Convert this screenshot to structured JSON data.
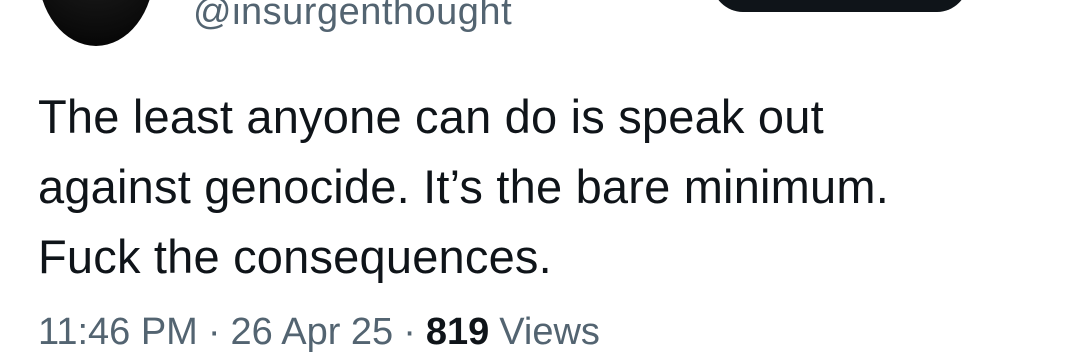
{
  "author": {
    "handle": "@insurgenthought"
  },
  "tweet": {
    "text": "The least anyone can do is speak out\nagainst genocide. It’s the bare minimum.\nFuck the consequences."
  },
  "meta": {
    "time": "11:46 PM",
    "separator": "·",
    "date": "26 Apr 25",
    "views_count": "819",
    "views_label": "Views"
  },
  "colors": {
    "text_primary": "#0f1419",
    "text_secondary": "#536471",
    "button_bg": "#0f1419",
    "background": "#ffffff"
  }
}
